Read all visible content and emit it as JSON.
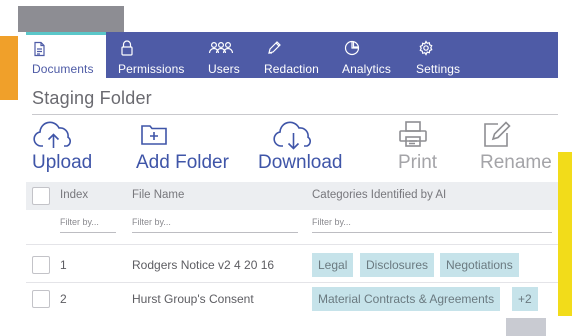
{
  "nav": {
    "tabs": [
      {
        "label": "Documents",
        "icon": "document-icon",
        "active": true
      },
      {
        "label": "Permissions",
        "icon": "lock-icon",
        "active": false
      },
      {
        "label": "Users",
        "icon": "users-icon",
        "active": false
      },
      {
        "label": "Redaction",
        "icon": "pen-icon",
        "active": false
      },
      {
        "label": "Analytics",
        "icon": "pie-chart-icon",
        "active": false
      },
      {
        "label": "Settings",
        "icon": "gear-icon",
        "active": false
      }
    ]
  },
  "folder": {
    "title": "Staging Folder"
  },
  "toolbar": {
    "upload": {
      "label": "Upload",
      "icon": "cloud-upload-icon"
    },
    "add_folder": {
      "label": "Add Folder",
      "icon": "folder-plus-icon"
    },
    "download": {
      "label": "Download",
      "icon": "cloud-download-icon"
    },
    "print": {
      "label": "Print",
      "icon": "printer-icon"
    },
    "rename": {
      "label": "Rename",
      "icon": "edit-icon"
    }
  },
  "table": {
    "columns": {
      "index": "Index",
      "file_name": "File Name",
      "categories": "Categories Identified by AI"
    },
    "filter_placeholder": "Filter by...",
    "rows": [
      {
        "index": "1",
        "file_name": "Rodgers Notice v2 4 20 16",
        "tags": [
          "Legal",
          "Disclosures",
          "Negotiations"
        ]
      },
      {
        "index": "2",
        "file_name": "Hurst Group's Consent",
        "tags": [
          "Material Contracts & Agreements",
          "+2"
        ]
      }
    ]
  },
  "colors": {
    "nav_bg": "#4e5ba6",
    "accent": "#3f55a8",
    "active_tab_top": "#5bc7c9",
    "tag_bg": "#c6e3ea"
  }
}
